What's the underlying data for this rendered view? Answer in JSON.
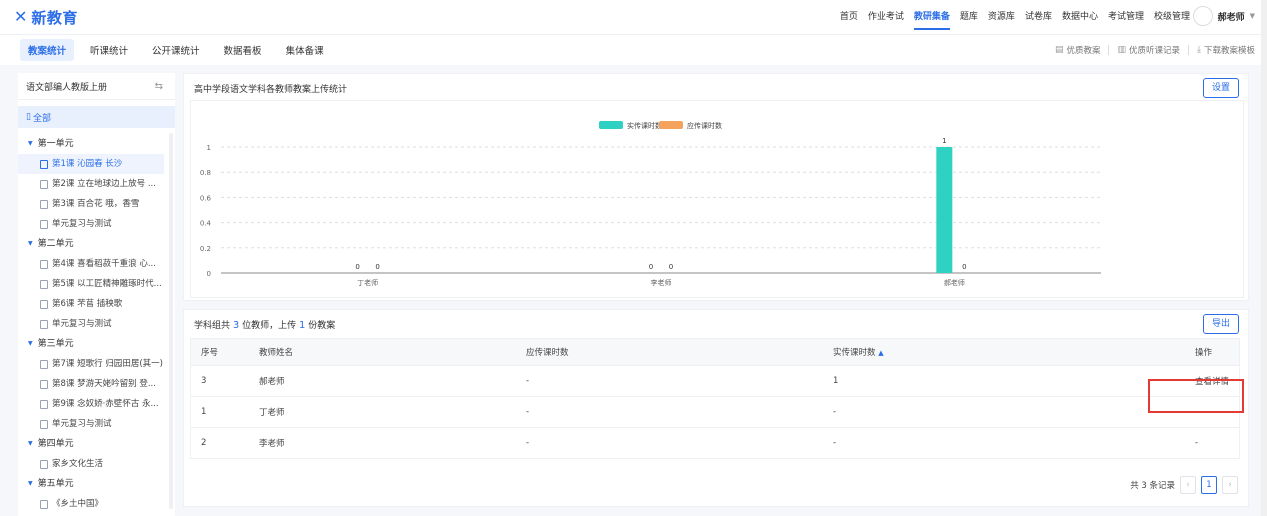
{
  "app": {
    "logo_mark": "✕",
    "logo_text": "新教育"
  },
  "topnav": {
    "items": [
      "首页",
      "作业考试",
      "教研集备",
      "题库",
      "资源库",
      "试卷库",
      "数据中心",
      "考试管理",
      "校级管理"
    ],
    "active_index": 2,
    "user_name": "郝老师"
  },
  "subnav": {
    "tabs": [
      "教案统计",
      "听课统计",
      "公开课统计",
      "数据看板",
      "集体备课"
    ],
    "active_index": 0,
    "actions": [
      "优质教案",
      "优质听课记录",
      "下载教案模板"
    ]
  },
  "sidebar": {
    "book": "语文部编人教版上册",
    "all_label": "全部",
    "units": [
      {
        "name": "第一单元",
        "lessons": [
          "第1课 沁园春 长沙",
          "第2课 立在地球边上放号 ...",
          "第3课 百合花  哦，香雪",
          "单元复习与测试"
        ]
      },
      {
        "name": "第二单元",
        "lessons": [
          "第4课 喜看稻菽千重浪  心...",
          "第5课 以工匠精神雕琢时代...",
          "第6课 芣苢  插秧歌",
          "单元复习与测试"
        ]
      },
      {
        "name": "第三单元",
        "lessons": [
          "第7课 短歌行  归园田居(其一)",
          "第8课 梦游天姥吟留别  登...",
          "第9课 念奴娇·赤壁怀古  永...",
          "单元复习与测试"
        ]
      },
      {
        "name": "第四单元",
        "lessons": [
          "家乡文化生活"
        ]
      },
      {
        "name": "第五单元",
        "lessons": [
          "《乡土中国》"
        ]
      }
    ]
  },
  "chart_panel": {
    "title": "高中学段语文学科各教师教案上传统计",
    "settings_label": "设置"
  },
  "chart_data": {
    "type": "bar",
    "categories": [
      "丁老师",
      "李老师",
      "郝老师"
    ],
    "series": [
      {
        "name": "实传课时数",
        "values": [
          0,
          0,
          1
        ],
        "color": "#2ed1c2"
      },
      {
        "name": "应传课时数",
        "values": [
          0,
          0,
          0
        ],
        "color": "#f5a25d"
      }
    ],
    "ylim": [
      0,
      1
    ],
    "yticks": [
      "0",
      "0.2",
      "0.4",
      "0.6",
      "0.8",
      "1"
    ],
    "legend": "top-center",
    "grid": true
  },
  "table_panel": {
    "summary_prefix": "学科组共",
    "teacher_count": "3",
    "summary_mid": "位教师，上传",
    "upload_count": "1",
    "summary_suffix": "份教案",
    "export_label": "导出",
    "columns": [
      "序号",
      "教师姓名",
      "应传课时数",
      "实传课时数",
      "操作"
    ],
    "rows": [
      {
        "no": "3",
        "name": "郝老师",
        "expected": "-",
        "actual": "1",
        "action": "查看详情"
      },
      {
        "no": "1",
        "name": "丁老师",
        "expected": "-",
        "actual": "-",
        "action": "-"
      },
      {
        "no": "2",
        "name": "李老师",
        "expected": "-",
        "actual": "-",
        "action": "-"
      }
    ],
    "total_label": "共 3 条记录",
    "current_page": "1"
  }
}
